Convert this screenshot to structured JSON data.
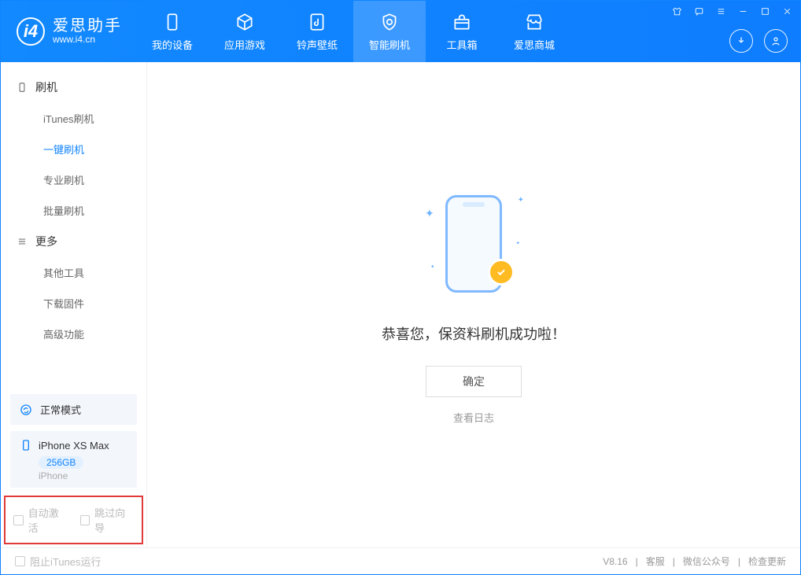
{
  "app": {
    "name": "爱思助手",
    "url": "www.i4.cn"
  },
  "tabs": {
    "device": "我的设备",
    "apps": "应用游戏",
    "ringtone": "铃声壁纸",
    "flash": "智能刷机",
    "toolbox": "工具箱",
    "store": "爱思商城"
  },
  "sidebar": {
    "group_flash": "刷机",
    "items_flash": [
      "iTunes刷机",
      "一键刷机",
      "专业刷机",
      "批量刷机"
    ],
    "group_more": "更多",
    "items_more": [
      "其他工具",
      "下载固件",
      "高级功能"
    ]
  },
  "device": {
    "mode": "正常模式",
    "name": "iPhone XS Max",
    "capacity": "256GB",
    "type": "iPhone"
  },
  "options": {
    "auto_activate": "自动激活",
    "skip_guide": "跳过向导"
  },
  "main": {
    "success": "恭喜您，保资料刷机成功啦！",
    "ok": "确定",
    "view_log": "查看日志"
  },
  "footer": {
    "block_itunes": "阻止iTunes运行",
    "version": "V8.16",
    "support": "客服",
    "wechat": "微信公众号",
    "update": "检查更新"
  }
}
